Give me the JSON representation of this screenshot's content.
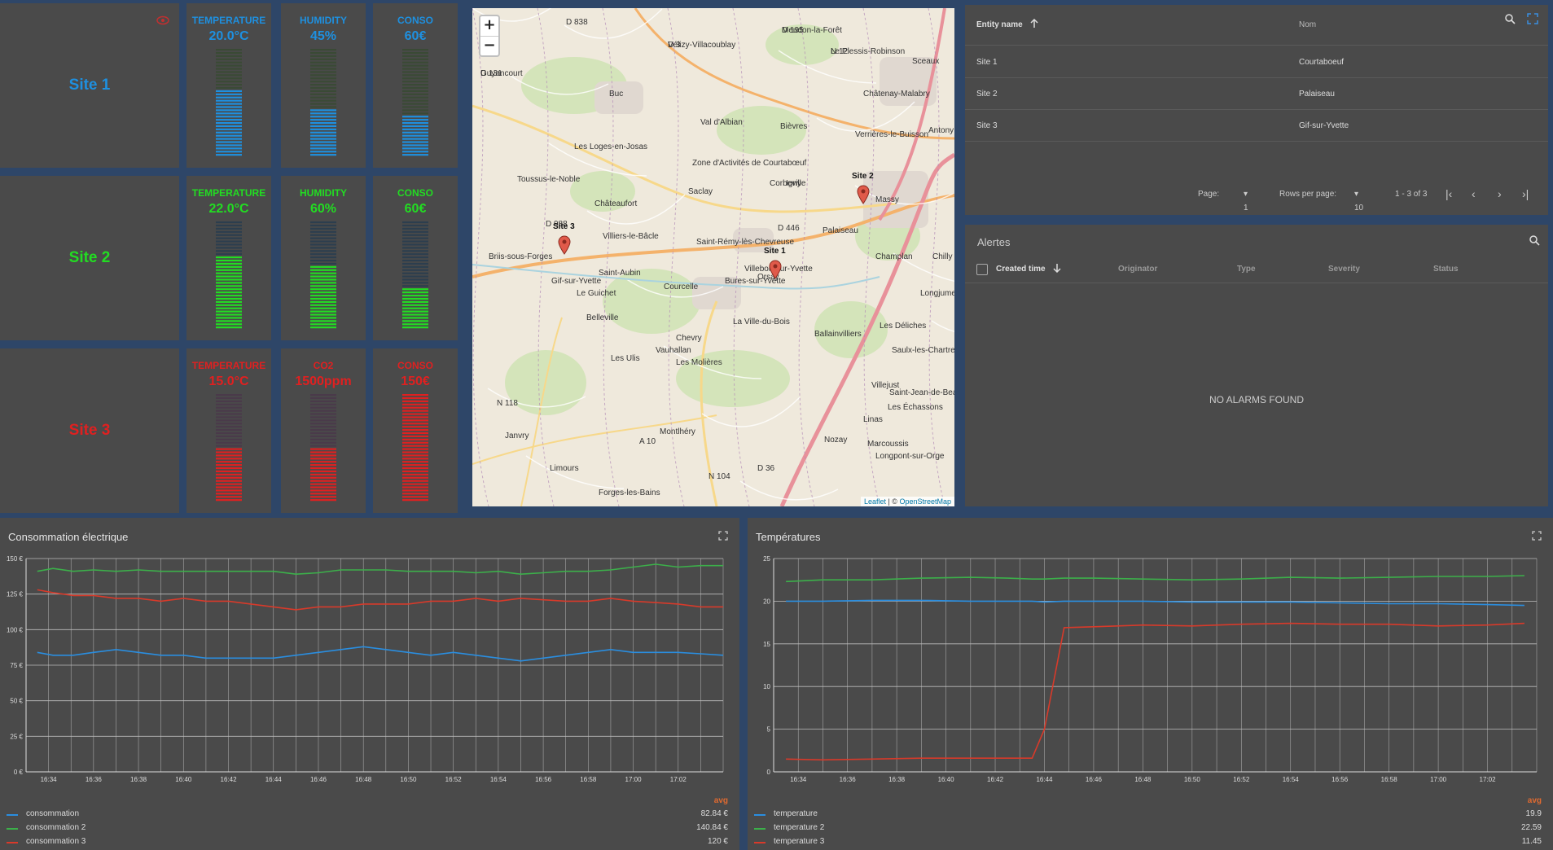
{
  "colors": {
    "blue": "#1e90e0",
    "green": "#22dd22",
    "red": "#e02020",
    "panel": "#4a4a4a",
    "background": "#2e4668"
  },
  "sites": [
    {
      "name": "Site 1",
      "color": "#1e90e0",
      "dim": "#3a4a35",
      "gauges": [
        {
          "title": "TEMPERATURE",
          "value": "20.0°C",
          "fill": 0.62
        },
        {
          "title": "HUMIDITY",
          "value": "45%",
          "fill": 0.45
        },
        {
          "title": "CONSO",
          "value": "60€",
          "fill": 0.38
        }
      ]
    },
    {
      "name": "Site 2",
      "color": "#22dd22",
      "dim": "#2c3e4e",
      "gauges": [
        {
          "title": "TEMPERATURE",
          "value": "22.0°C",
          "fill": 0.68
        },
        {
          "title": "HUMIDITY",
          "value": "60%",
          "fill": 0.58
        },
        {
          "title": "CONSO",
          "value": "60€",
          "fill": 0.38
        }
      ]
    },
    {
      "name": "Site 3",
      "color": "#e02020",
      "dim": "#4a3a4a",
      "gauges": [
        {
          "title": "TEMPERATURE",
          "value": "15.0°C",
          "fill": 0.5
        },
        {
          "title": "CO2",
          "value": "1500ppm",
          "fill": 0.5
        },
        {
          "title": "CONSO",
          "value": "150€",
          "fill": 1.0
        }
      ]
    }
  ],
  "map": {
    "zoom_in": "+",
    "zoom_out": "−",
    "attribution_leaflet": "Leaflet",
    "attribution_sep": " | © ",
    "attribution_osm": "OpenStreetMap",
    "markers": [
      "Site 3",
      "Site 1",
      "Site 2"
    ],
    "place_labels": [
      "Guyancourt",
      "Vélizy-Villacoublay",
      "Meudon-la-Forêt",
      "Le Plessis-Robinson",
      "Sceaux",
      "Châtenay-Malabry",
      "Antony",
      "Verrières-le-Buisson",
      "Massy",
      "Palaiseau",
      "Champlan",
      "Chilly",
      "Longjumeau",
      "Igny",
      "Saclay",
      "Bièvres",
      "Val d'Albian",
      "Buc",
      "Les Loges-en-Josas",
      "Toussus-le-Noble",
      "Châteaufort",
      "Villiers-le-Bâcle",
      "Saint-Aubin",
      "Gif-sur-Yvette",
      "Courcelle",
      "Bures-sur-Yvette",
      "Orsay",
      "Villebon-sur-Yvette",
      "Le Guichet",
      "Belleville",
      "Chevry",
      "Les Ulis",
      "Les Molières",
      "Saint-Jean-de-Beauregard",
      "Nozay",
      "Marcoussis",
      "Montlhéry",
      "Janvry",
      "Limours",
      "Forges-les-Bains",
      "Briis-sous-Forges",
      "Saint-Rémy-lès-Chevreuse",
      "Corbeville",
      "Vauhallan",
      "Les Déliches",
      "Saulx-les-Chartreux",
      "Ballainvilliers",
      "Villejust",
      "Les Échassons",
      "Longpont-sur-Orge",
      "Linas",
      "La Ville-du-Bois",
      "Zone d'Activités de Courtabœuf",
      "D 446",
      "D 36",
      "N 118",
      "A 10",
      "N 104",
      "D 988",
      "D 838",
      "D 131",
      "D 3",
      "D 195",
      "N 12"
    ]
  },
  "entity_table": {
    "col_entity": "Entity name",
    "col_nom": "Nom",
    "rows": [
      {
        "entity": "Site 1",
        "nom": "Courtaboeuf"
      },
      {
        "entity": "Site 2",
        "nom": "Palaiseau"
      },
      {
        "entity": "Site 3",
        "nom": "Gif-sur-Yvette"
      }
    ],
    "page_label": "Page:",
    "page_value": "1",
    "rows_per_page_label": "Rows per page:",
    "rows_per_page_value": "10",
    "range": "1 - 3 of 3"
  },
  "alerts": {
    "title": "Alertes",
    "columns": [
      "Created time",
      "Originator",
      "Type",
      "Severity",
      "Status"
    ],
    "empty": "NO ALARMS FOUND"
  },
  "chart_data": [
    {
      "type": "line",
      "title": "Consommation électrique",
      "xlabel": "",
      "ylabel": "",
      "ylim": [
        0,
        150
      ],
      "yticks": [
        "0 €",
        "25 €",
        "50 €",
        "75 €",
        "100 €",
        "125 €",
        "150 €"
      ],
      "xticks": [
        "16:34",
        "16:36",
        "16:38",
        "16:40",
        "16:42",
        "16:44",
        "16:46",
        "16:48",
        "16:50",
        "16:52",
        "16:54",
        "16:56",
        "16:58",
        "17:00",
        "17:02"
      ],
      "x_minutes": [
        33.5,
        34.2,
        35.1,
        36,
        37,
        38,
        39,
        40,
        41,
        42,
        43,
        44,
        45,
        46,
        47,
        48,
        49,
        50,
        51,
        52,
        53,
        54,
        55,
        56,
        57,
        58,
        59,
        60,
        61,
        62,
        63,
        64
      ],
      "series": [
        {
          "name": "consommation",
          "color": "#2a8ee0",
          "avg": "82.84 €",
          "values": [
            84,
            82,
            82,
            84,
            86,
            84,
            82,
            82,
            80,
            80,
            80,
            80,
            82,
            84,
            86,
            88,
            86,
            84,
            82,
            84,
            82,
            80,
            78,
            80,
            82,
            84,
            86,
            84,
            84,
            84,
            83,
            82
          ]
        },
        {
          "name": "consommation 2",
          "color": "#3cb04a",
          "avg": "140.84 €",
          "values": [
            141,
            143,
            141,
            142,
            141,
            142,
            141,
            141,
            141,
            141,
            141,
            141,
            139,
            140,
            142,
            142,
            142,
            141,
            141,
            141,
            140,
            141,
            139,
            140,
            141,
            141,
            142,
            144,
            146,
            144,
            145,
            145
          ]
        },
        {
          "name": "consommation 3",
          "color": "#d83a2a",
          "avg": "120 €",
          "values": [
            128,
            126,
            124,
            124,
            122,
            122,
            120,
            122,
            120,
            120,
            118,
            116,
            114,
            116,
            116,
            118,
            118,
            118,
            120,
            120,
            122,
            120,
            122,
            121,
            120,
            120,
            122,
            120,
            119,
            118,
            116,
            116
          ]
        }
      ],
      "legend_header": "avg"
    },
    {
      "type": "line",
      "title": "Températures",
      "xlabel": "",
      "ylabel": "",
      "ylim": [
        0,
        25
      ],
      "yticks": [
        "0",
        "5",
        "10",
        "15",
        "20",
        "25"
      ],
      "xticks": [
        "16:34",
        "16:36",
        "16:38",
        "16:40",
        "16:42",
        "16:44",
        "16:46",
        "16:48",
        "16:50",
        "16:52",
        "16:54",
        "16:56",
        "16:58",
        "17:00",
        "17:02"
      ],
      "x_minutes": [
        33.5,
        35,
        37,
        39,
        41,
        42.5,
        43.5,
        44,
        44.8,
        46,
        48,
        50,
        52,
        54,
        56,
        58,
        60,
        62,
        63.5
      ],
      "series": [
        {
          "name": "temperature",
          "color": "#2a8ee0",
          "avg": "19.9",
          "values": [
            20.0,
            20.0,
            20.1,
            20.1,
            20.0,
            20.0,
            20.0,
            19.9,
            20.0,
            20.0,
            20.0,
            19.9,
            19.9,
            19.9,
            19.8,
            19.7,
            19.7,
            19.6,
            19.5
          ]
        },
        {
          "name": "temperature 2",
          "color": "#3cb04a",
          "avg": "22.59",
          "values": [
            22.3,
            22.5,
            22.5,
            22.7,
            22.8,
            22.7,
            22.6,
            22.6,
            22.7,
            22.7,
            22.6,
            22.5,
            22.6,
            22.8,
            22.7,
            22.8,
            22.9,
            22.9,
            23.0
          ]
        },
        {
          "name": "temperature 3",
          "color": "#d83a2a",
          "avg": "11.45",
          "values": [
            1.5,
            1.4,
            1.5,
            1.6,
            1.6,
            1.6,
            1.6,
            5.0,
            16.9,
            17.0,
            17.2,
            17.1,
            17.3,
            17.4,
            17.3,
            17.3,
            17.1,
            17.2,
            17.4
          ]
        }
      ],
      "legend_header": "avg"
    }
  ]
}
